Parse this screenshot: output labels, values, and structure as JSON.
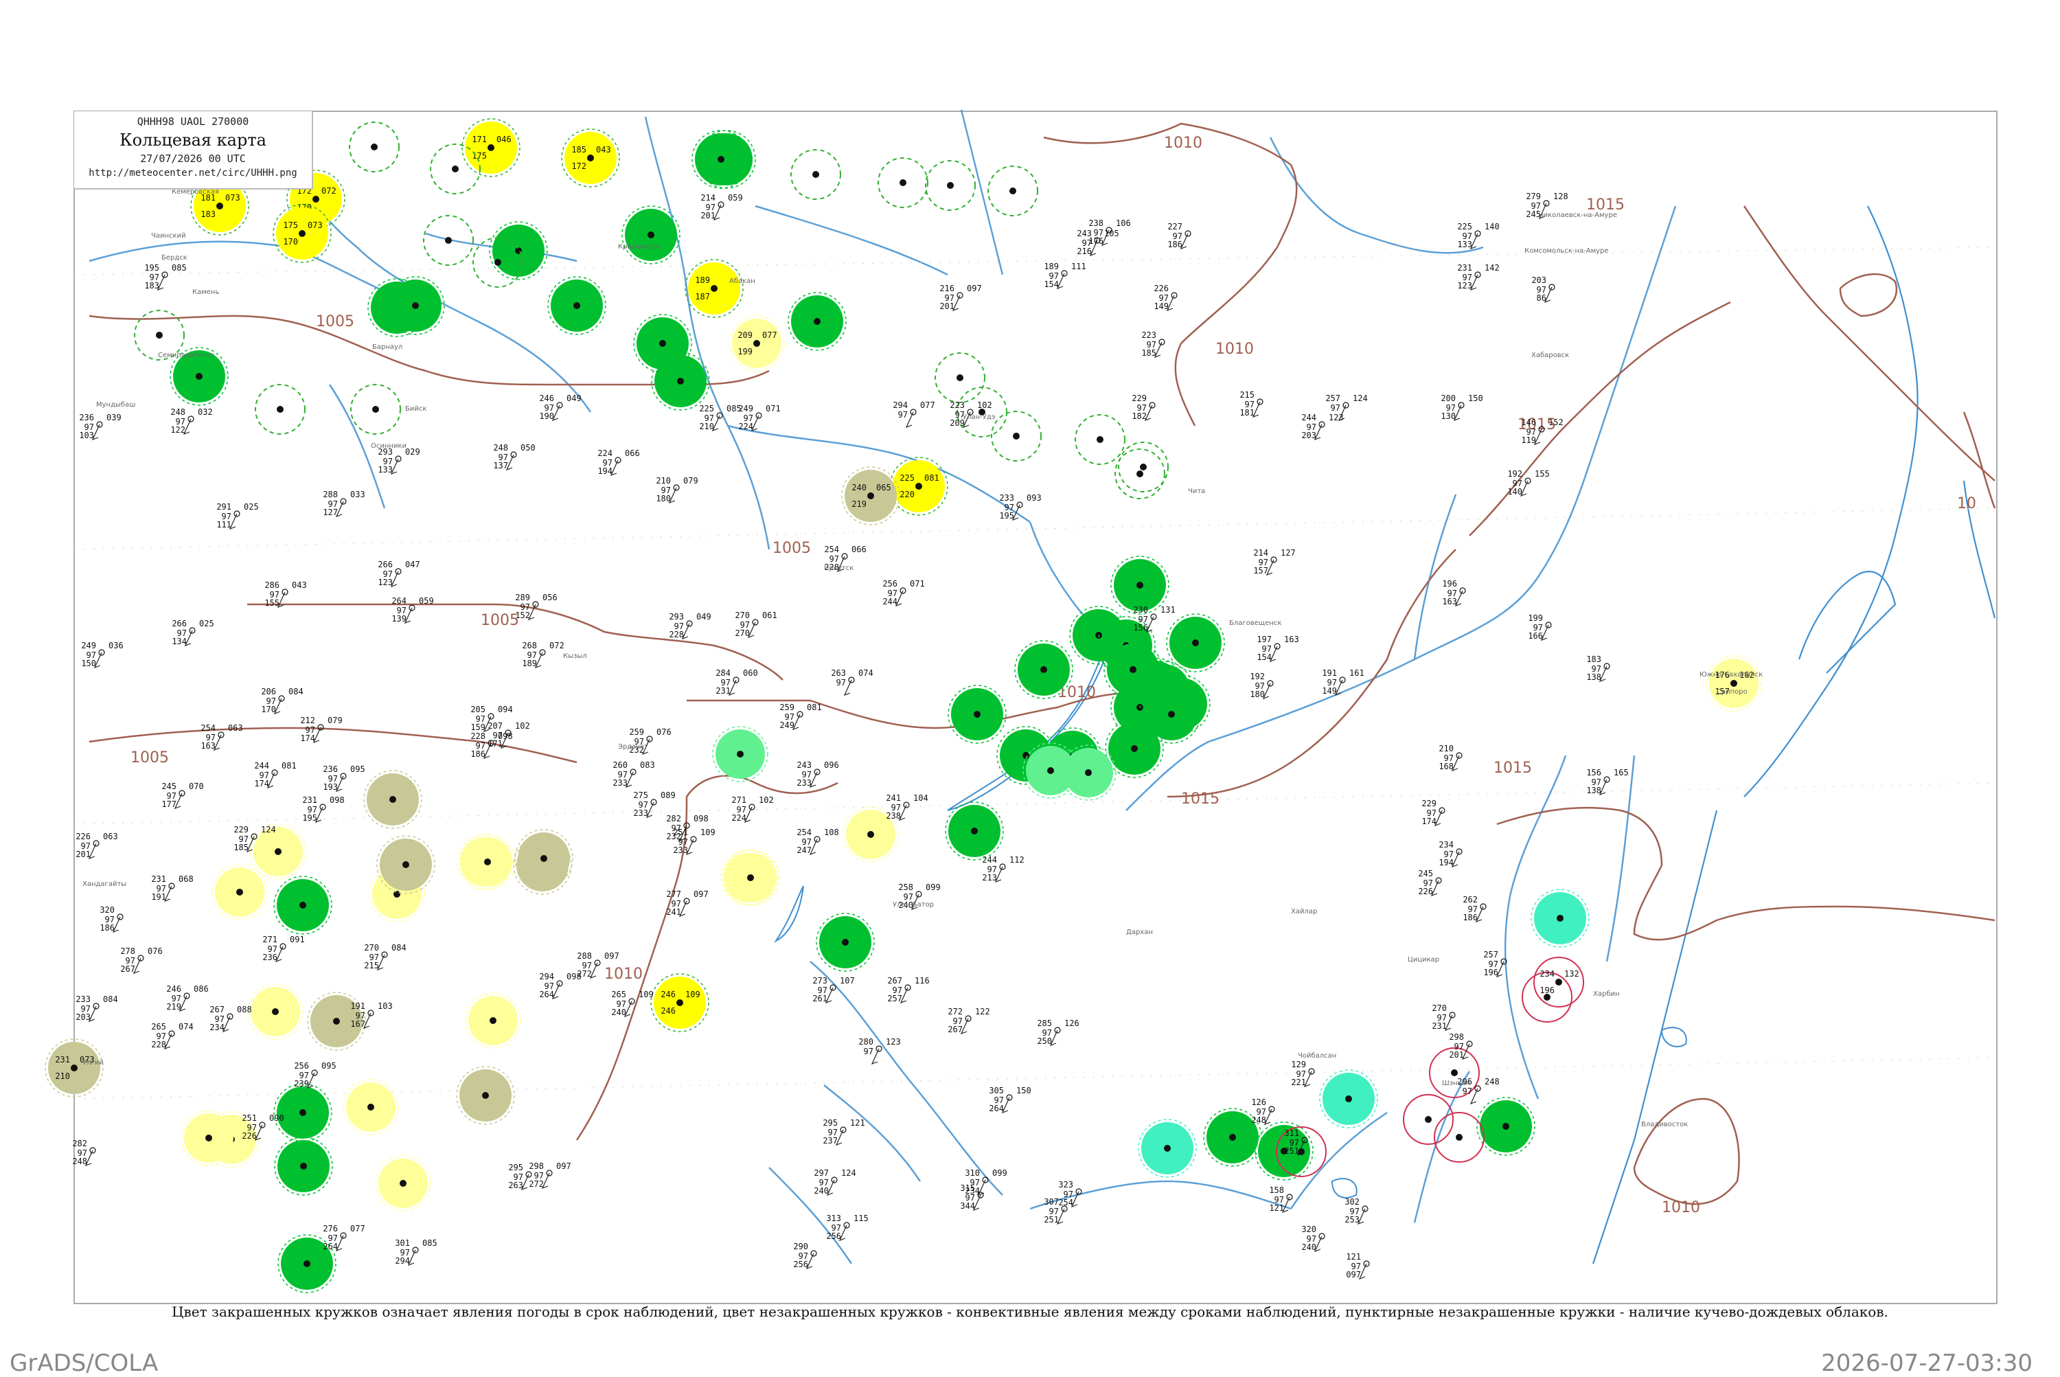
{
  "header": {
    "code": "QHHH98  UAOL  270000",
    "title": "Кольцевая карта",
    "date": "27/07/2026 00 UTC",
    "url": "http://meteocenter.net/circ/UHHH.png"
  },
  "caption": "Цвет закрашенных кружков означает явления погоды в срок наблюдений, цвет незакрашенных кружков - конвективные явления между сроками наблюдений, пунктирные незакрашенные кружки - наличие кучево-дождевых облаков.",
  "footer": {
    "left": "GrADS/COLA",
    "right": "2026-07-27-03:30"
  },
  "colors": {
    "green": "#00c030",
    "yellow": "#ffff00",
    "paleyellow": "#ffff99",
    "olive": "#c8c896",
    "cyan": "#40f0c0",
    "lightgreen": "#60f090",
    "dashgreen": "#30b030",
    "red": "#d03050",
    "isobar": "#a06050",
    "river": "#3f8fd0"
  },
  "isobars": [
    {
      "label": "1010",
      "id": "iso-1010-n"
    },
    {
      "label": "1005",
      "id": "iso-1005-w"
    },
    {
      "label": "1005",
      "id": "iso-1005-c"
    },
    {
      "label": "1005",
      "id": "iso-1005-sw"
    },
    {
      "label": "1005",
      "id": "iso-1005-mid"
    },
    {
      "label": "1010",
      "id": "iso-1010-ne"
    },
    {
      "label": "1010",
      "id": "iso-1010-c"
    },
    {
      "label": "1010",
      "id": "iso-1010-s"
    },
    {
      "label": "1015",
      "id": "iso-1015-e"
    },
    {
      "label": "1015",
      "id": "iso-1015-se"
    },
    {
      "label": "1015",
      "id": "iso-1015-s"
    },
    {
      "label": "1015",
      "id": "iso-1015-ne"
    },
    {
      "label": "1010",
      "id": "iso-1010-se"
    },
    {
      "label": "10",
      "id": "iso-10-edge"
    }
  ],
  "circles": [
    {
      "type": "yellow",
      "t": "181",
      "p": "073",
      "td": "183"
    },
    {
      "type": "yellow",
      "t": "172",
      "p": "072",
      "td": "170"
    },
    {
      "type": "yellow",
      "t": "175",
      "p": "073",
      "td": "170"
    },
    {
      "type": "yellow",
      "t": "171",
      "p": "046",
      "td": "175"
    },
    {
      "type": "yellow",
      "t": "185",
      "p": "043",
      "td": "172"
    },
    {
      "type": "yellow",
      "t": "189",
      "p": "",
      "td": "187"
    },
    {
      "type": "yellow",
      "t": "225",
      "p": "081",
      "td": "220"
    },
    {
      "type": "yellow",
      "t": "246",
      "p": "109",
      "td": "246"
    },
    {
      "type": "green",
      "t": "",
      "p": "",
      "td": ""
    },
    {
      "type": "green",
      "t": "",
      "p": "",
      "td": ""
    },
    {
      "type": "green",
      "t": "",
      "p": "",
      "td": ""
    },
    {
      "type": "green",
      "t": "",
      "p": "",
      "td": ""
    },
    {
      "type": "green",
      "t": "",
      "p": "",
      "td": ""
    },
    {
      "type": "green",
      "t": "",
      "p": "",
      "td": ""
    },
    {
      "type": "green",
      "t": "",
      "p": "",
      "td": ""
    },
    {
      "type": "green",
      "t": "",
      "p": "",
      "td": ""
    },
    {
      "type": "green",
      "t": "",
      "p": "",
      "td": ""
    },
    {
      "type": "green",
      "t": "",
      "p": "",
      "td": ""
    },
    {
      "type": "green",
      "t": "",
      "p": "",
      "td": ""
    },
    {
      "type": "green",
      "t": "",
      "p": "",
      "td": ""
    },
    {
      "type": "green",
      "t": "",
      "p": "",
      "td": ""
    },
    {
      "type": "green",
      "t": "",
      "p": "",
      "td": ""
    },
    {
      "type": "green",
      "t": "",
      "p": "",
      "td": ""
    },
    {
      "type": "green",
      "t": "",
      "p": "",
      "td": ""
    },
    {
      "type": "green",
      "t": "",
      "p": "",
      "td": ""
    },
    {
      "type": "green",
      "t": "",
      "p": "",
      "td": ""
    },
    {
      "type": "green",
      "t": "",
      "p": "",
      "td": ""
    },
    {
      "type": "green",
      "t": "",
      "p": "",
      "td": ""
    },
    {
      "type": "green",
      "t": "",
      "p": "",
      "td": ""
    },
    {
      "type": "green",
      "t": "",
      "p": "",
      "td": ""
    },
    {
      "type": "green",
      "t": "",
      "p": "",
      "td": ""
    },
    {
      "type": "green",
      "t": "",
      "p": "",
      "td": ""
    },
    {
      "type": "green",
      "t": "",
      "p": "",
      "td": ""
    },
    {
      "type": "green",
      "t": "",
      "p": "",
      "td": ""
    },
    {
      "type": "green",
      "t": "",
      "p": "",
      "td": ""
    },
    {
      "type": "green",
      "t": "",
      "p": "",
      "td": ""
    },
    {
      "type": "green",
      "t": "",
      "p": "",
      "td": ""
    },
    {
      "type": "green",
      "t": "",
      "p": "",
      "td": ""
    },
    {
      "type": "green",
      "t": "",
      "p": "",
      "td": ""
    },
    {
      "type": "green",
      "t": "",
      "p": "",
      "td": ""
    },
    {
      "type": "green",
      "t": "",
      "p": "",
      "td": ""
    },
    {
      "type": "green",
      "t": "",
      "p": "",
      "td": ""
    },
    {
      "type": "green",
      "t": "",
      "p": "",
      "td": ""
    },
    {
      "type": "paleyellow",
      "t": "209",
      "p": "077",
      "td": "199"
    },
    {
      "type": "paleyellow",
      "t": "",
      "p": "",
      "td": ""
    },
    {
      "type": "paleyellow",
      "t": "",
      "p": "",
      "td": ""
    },
    {
      "type": "paleyellow",
      "t": "",
      "p": "",
      "td": ""
    },
    {
      "type": "paleyellow",
      "t": "",
      "p": "",
      "td": ""
    },
    {
      "type": "paleyellow",
      "t": "",
      "p": "",
      "td": ""
    },
    {
      "type": "paleyellow",
      "t": "",
      "p": "",
      "td": ""
    },
    {
      "type": "paleyellow",
      "t": "",
      "p": "",
      "td": ""
    },
    {
      "type": "paleyellow",
      "t": "",
      "p": "",
      "td": ""
    },
    {
      "type": "paleyellow",
      "t": "",
      "p": "",
      "td": ""
    },
    {
      "type": "paleyellow",
      "t": "",
      "p": "",
      "td": ""
    },
    {
      "type": "paleyellow",
      "t": "",
      "p": "",
      "td": ""
    },
    {
      "type": "paleyellow",
      "t": "",
      "p": "",
      "td": ""
    },
    {
      "type": "paleyellow",
      "t": "",
      "p": "",
      "td": ""
    },
    {
      "type": "paleyellow",
      "t": "",
      "p": "",
      "td": ""
    },
    {
      "type": "paleyellow",
      "t": "",
      "p": "",
      "td": ""
    },
    {
      "type": "olive",
      "t": "240",
      "p": "065",
      "td": "219"
    },
    {
      "type": "olive",
      "t": "",
      "p": "",
      "td": ""
    },
    {
      "type": "olive",
      "t": "",
      "p": "",
      "td": ""
    },
    {
      "type": "olive",
      "t": "",
      "p": "",
      "td": ""
    },
    {
      "type": "olive",
      "t": "",
      "p": "",
      "td": ""
    },
    {
      "type": "olive",
      "t": "231",
      "p": "073",
      "td": "210"
    },
    {
      "type": "olive",
      "t": "",
      "p": "",
      "td": ""
    },
    {
      "type": "olive",
      "t": "",
      "p": "",
      "td": ""
    },
    {
      "type": "lightgreen",
      "t": "",
      "p": "",
      "td": ""
    },
    {
      "type": "lightgreen",
      "t": "",
      "p": "",
      "td": ""
    },
    {
      "type": "lightgreen",
      "t": "",
      "p": "",
      "td": ""
    },
    {
      "type": "cyan",
      "t": "",
      "p": "",
      "td": ""
    },
    {
      "type": "cyan",
      "t": "",
      "p": "",
      "td": ""
    },
    {
      "type": "cyan",
      "t": "",
      "p": "",
      "td": ""
    },
    {
      "type": "dashgreen",
      "t": "",
      "p": "",
      "td": ""
    },
    {
      "type": "dashgreen",
      "t": "",
      "p": "",
      "td": ""
    },
    {
      "type": "dashgreen",
      "t": "",
      "p": "",
      "td": ""
    },
    {
      "type": "dashgreen",
      "t": "",
      "p": "",
      "td": ""
    },
    {
      "type": "dashgreen",
      "t": "",
      "p": "",
      "td": ""
    },
    {
      "type": "dashgreen",
      "t": "",
      "p": "",
      "td": ""
    },
    {
      "type": "dashgreen",
      "t": "",
      "p": "",
      "td": ""
    },
    {
      "type": "dashgreen",
      "t": "",
      "p": "",
      "td": ""
    },
    {
      "type": "dashgreen",
      "t": "",
      "p": "",
      "td": ""
    },
    {
      "type": "dashgreen",
      "t": "",
      "p": "",
      "td": ""
    },
    {
      "type": "dashgreen",
      "t": "",
      "p": "",
      "td": ""
    },
    {
      "type": "dashgreen",
      "t": "",
      "p": "",
      "td": ""
    },
    {
      "type": "dashgreen",
      "t": "",
      "p": "",
      "td": ""
    },
    {
      "type": "dashgreen",
      "t": "",
      "p": "",
      "td": ""
    },
    {
      "type": "dashgreen",
      "t": "",
      "p": "",
      "td": ""
    },
    {
      "type": "dashgreen",
      "t": "",
      "p": "",
      "td": ""
    },
    {
      "type": "dashgreen",
      "t": "",
      "p": "",
      "td": ""
    },
    {
      "type": "red",
      "t": "",
      "p": "",
      "td": ""
    },
    {
      "type": "red",
      "t": "",
      "p": "",
      "td": ""
    },
    {
      "type": "red",
      "t": "",
      "p": "",
      "td": ""
    },
    {
      "type": "red",
      "t": "234",
      "p": "132",
      "td": "196"
    },
    {
      "type": "red",
      "t": "",
      "p": "",
      "td": ""
    },
    {
      "type": "red",
      "t": "",
      "p": "",
      "td": ""
    },
    {
      "type": "paleyellow",
      "t": "176",
      "p": "162",
      "td": "157"
    }
  ],
  "stations": [
    {
      "t": "195",
      "p": "085",
      "td": "183"
    },
    {
      "t": "236",
      "p": "039",
      "td": "103"
    },
    {
      "t": "248",
      "p": "032",
      "td": "122"
    },
    {
      "t": "291",
      "p": "025",
      "td": "111"
    },
    {
      "t": "288",
      "p": "033",
      "td": "127"
    },
    {
      "t": "293",
      "p": "029",
      "td": "133"
    },
    {
      "t": "286",
      "p": "043",
      "td": "155"
    },
    {
      "t": "266",
      "p": "025",
      "td": "134"
    },
    {
      "t": "249",
      "p": "036",
      "td": "150"
    },
    {
      "t": "266",
      "p": "047",
      "td": "123"
    },
    {
      "t": "264",
      "p": "059",
      "td": "139"
    },
    {
      "t": "289",
      "p": "056",
      "td": "152"
    },
    {
      "t": "268",
      "p": "072",
      "td": "189"
    },
    {
      "t": "246",
      "p": "049",
      "td": "190"
    },
    {
      "t": "248",
      "p": "050",
      "td": "137"
    },
    {
      "t": "224",
      "p": "066",
      "td": "194"
    },
    {
      "t": "210",
      "p": "079",
      "td": "180"
    },
    {
      "t": "225",
      "p": "085",
      "td": "210"
    },
    {
      "t": "249",
      "p": "071",
      "td": "224"
    },
    {
      "t": "294",
      "p": "077",
      "td": ""
    },
    {
      "t": "214",
      "p": "059",
      "td": "201"
    },
    {
      "t": "216",
      "p": "097",
      "td": "201"
    },
    {
      "t": "223",
      "p": "102",
      "td": "209"
    },
    {
      "t": "233",
      "p": "093",
      "td": "195"
    },
    {
      "t": "254",
      "p": "066",
      "td": "228"
    },
    {
      "t": "256",
      "p": "071",
      "td": "244"
    },
    {
      "t": "270",
      "p": "061",
      "td": "270"
    },
    {
      "t": "263",
      "p": "074",
      "td": ""
    },
    {
      "t": "284",
      "p": "060",
      "td": "231"
    },
    {
      "t": "293",
      "p": "049",
      "td": "228"
    },
    {
      "t": "259",
      "p": "081",
      "td": "249"
    },
    {
      "t": "259",
      "p": "076",
      "td": "232"
    },
    {
      "t": "260",
      "p": "083",
      "td": "233"
    },
    {
      "t": "243",
      "p": "096",
      "td": "233"
    },
    {
      "t": "275",
      "p": "089",
      "td": "233"
    },
    {
      "t": "282",
      "p": "098",
      "td": "232"
    },
    {
      "t": "241",
      "p": "104",
      "td": "238"
    },
    {
      "t": "271",
      "p": "102",
      "td": "224"
    },
    {
      "t": "251",
      "p": "109",
      "td": "233"
    },
    {
      "t": "254",
      "p": "108",
      "td": "247"
    },
    {
      "t": "244",
      "p": "112",
      "td": "213"
    },
    {
      "t": "258",
      "p": "099",
      "td": "240"
    },
    {
      "t": "277",
      "p": "097",
      "td": "241"
    },
    {
      "t": "288",
      "p": "097",
      "td": "272"
    },
    {
      "t": "294",
      "p": "098",
      "td": "264"
    },
    {
      "t": "265",
      "p": "109",
      "td": "240"
    },
    {
      "t": "273",
      "p": "107",
      "td": "261"
    },
    {
      "t": "267",
      "p": "116",
      "td": "257"
    },
    {
      "t": "272",
      "p": "122",
      "td": "267"
    },
    {
      "t": "280",
      "p": "123",
      "td": ""
    },
    {
      "t": "295",
      "p": "121",
      "td": "237"
    },
    {
      "t": "297",
      "p": "124",
      "td": "240"
    },
    {
      "t": "310",
      "p": "099",
      "td": "234"
    },
    {
      "t": "305",
      "p": "150",
      "td": "264"
    },
    {
      "t": "313",
      "p": "115",
      "td": "256"
    },
    {
      "t": "290",
      "p": "",
      "td": "256"
    },
    {
      "t": "315",
      "p": "",
      "td": "344"
    },
    {
      "t": "323",
      "p": "",
      "td": "254"
    },
    {
      "t": "307",
      "p": "",
      "td": "251"
    },
    {
      "t": "285",
      "p": "126",
      "td": "250"
    },
    {
      "t": "206",
      "p": "084",
      "td": "170"
    },
    {
      "t": "212",
      "p": "079",
      "td": "174"
    },
    {
      "t": "254",
      "p": "063",
      "td": "163"
    },
    {
      "t": "244",
      "p": "081",
      "td": "174"
    },
    {
      "t": "245",
      "p": "070",
      "td": "177"
    },
    {
      "t": "236",
      "p": "095",
      "td": "193"
    },
    {
      "t": "231",
      "p": "098",
      "td": "195"
    },
    {
      "t": "226",
      "p": "063",
      "td": "201"
    },
    {
      "t": "229",
      "p": "124",
      "td": "185"
    },
    {
      "t": "231",
      "p": "068",
      "td": "191"
    },
    {
      "t": "320",
      "p": "",
      "td": "186"
    },
    {
      "t": "278",
      "p": "076",
      "td": "267"
    },
    {
      "t": "271",
      "p": "091",
      "td": "236"
    },
    {
      "t": "270",
      "p": "084",
      "td": "215"
    },
    {
      "t": "233",
      "p": "084",
      "td": "203"
    },
    {
      "t": "246",
      "p": "086",
      "td": "219"
    },
    {
      "t": "265",
      "p": "074",
      "td": "228"
    },
    {
      "t": "267",
      "p": "088",
      "td": "234"
    },
    {
      "t": "282",
      "p": "",
      "td": "248"
    },
    {
      "t": "191",
      "p": "103",
      "td": "167"
    },
    {
      "t": "256",
      "p": "095",
      "td": "239"
    },
    {
      "t": "251",
      "p": "090",
      "td": "226"
    },
    {
      "t": "298",
      "p": "097",
      "td": "272"
    },
    {
      "t": "295",
      "p": "",
      "td": "263"
    },
    {
      "t": "301",
      "p": "085",
      "td": "294"
    },
    {
      "t": "276",
      "p": "077",
      "td": "264"
    },
    {
      "t": "205",
      "p": "094",
      "td": "159"
    },
    {
      "t": "228",
      "p": "098",
      "td": "186"
    },
    {
      "t": "207",
      "p": "102",
      "td": "171"
    },
    {
      "t": "189",
      "p": "111",
      "td": "154"
    },
    {
      "t": "243",
      "p": "105",
      "td": "216"
    },
    {
      "t": "238",
      "p": "106",
      "td": "176"
    },
    {
      "t": "227",
      "p": "",
      "td": "186"
    },
    {
      "t": "226",
      "p": "",
      "td": "149"
    },
    {
      "t": "223",
      "p": "",
      "td": "185"
    },
    {
      "t": "229",
      "p": "",
      "td": "182"
    },
    {
      "t": "215",
      "p": "",
      "td": "181"
    },
    {
      "t": "244",
      "p": "123",
      "td": "203"
    },
    {
      "t": "257",
      "p": "124",
      "td": ""
    },
    {
      "t": "214",
      "p": "127",
      "td": "157"
    },
    {
      "t": "230",
      "p": "131",
      "td": "156"
    },
    {
      "t": "197",
      "p": "163",
      "td": "154"
    },
    {
      "t": "192",
      "p": "",
      "td": "180"
    },
    {
      "t": "191",
      "p": "161",
      "td": "149"
    },
    {
      "t": "196",
      "p": "",
      "td": "163"
    },
    {
      "t": "225",
      "p": "140",
      "td": "133"
    },
    {
      "t": "231",
      "p": "142",
      "td": "123"
    },
    {
      "t": "200",
      "p": "150",
      "td": "130"
    },
    {
      "t": "203",
      "p": "",
      "td": "86"
    },
    {
      "t": "146",
      "p": "152",
      "td": "119"
    },
    {
      "t": "192",
      "p": "155",
      "td": "140"
    },
    {
      "t": "199",
      "p": "",
      "td": "166"
    },
    {
      "t": "183",
      "p": "",
      "td": "138"
    },
    {
      "t": "156",
      "p": "165",
      "td": "138"
    },
    {
      "t": "210",
      "p": "",
      "td": "168"
    },
    {
      "t": "229",
      "p": "",
      "td": "174"
    },
    {
      "t": "234",
      "p": "",
      "td": "194"
    },
    {
      "t": "245",
      "p": "",
      "td": "226"
    },
    {
      "t": "262",
      "p": "",
      "td": "186"
    },
    {
      "t": "257",
      "p": "",
      "td": "196"
    },
    {
      "t": "270",
      "p": "",
      "td": "231"
    },
    {
      "t": "298",
      "p": "",
      "td": "201"
    },
    {
      "t": "296",
      "p": "248",
      "td": ""
    },
    {
      "t": "279",
      "p": "128",
      "td": "245"
    },
    {
      "t": "126",
      "p": "",
      "td": "248"
    },
    {
      "t": "129",
      "p": "",
      "td": "221"
    },
    {
      "t": "311",
      "p": "",
      "td": "251"
    },
    {
      "t": "302",
      "p": "",
      "td": "253"
    },
    {
      "t": "320",
      "p": "",
      "td": "240"
    },
    {
      "t": "121",
      "p": "",
      "td": "097"
    },
    {
      "t": "158",
      "p": "",
      "td": "121"
    }
  ],
  "place_labels": [
    "Кемеровская",
    "Чаинский",
    "Бердск",
    "Камень",
    "Мундыбаш",
    "Осинники",
    "Бийск",
    "Барнаул",
    "Семипалатинск",
    "Красноярск",
    "Абакан",
    "Кызыл",
    "Иркутск",
    "Улан-Удэ",
    "Чита",
    "Хабаровск",
    "Благовещенск",
    "Комсомольск-на-Амуре",
    "Николаевск-на-Амуре",
    "Южно-Сахалинск",
    "Владивосток",
    "Улан-Батор",
    "Хандагайты",
    "Эрдэнэт",
    "Улгий",
    "Дархан",
    "Чойбалсан",
    "Харбин",
    "Шэньян",
    "Хайлар",
    "Цицикар",
    "Саппоро"
  ]
}
